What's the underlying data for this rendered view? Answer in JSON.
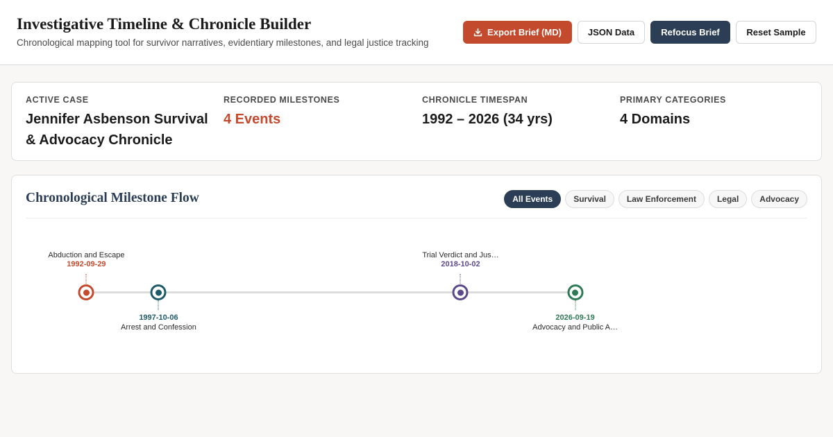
{
  "header": {
    "title": "Investigative Timeline & Chronicle Builder",
    "subtitle": "Chronological mapping tool for survivor narratives, evidentiary milestones, and legal justice tracking",
    "buttons": {
      "export": "Export Brief (MD)",
      "export_icon": "download-icon",
      "json": "JSON Data",
      "refocus": "Refocus Brief",
      "reset": "Reset Sample"
    }
  },
  "stats": [
    {
      "label": "ACTIVE CASE",
      "value": "Jennifer Asbenson Survival & Advocacy Chronicle"
    },
    {
      "label": "RECORDED MILESTONES",
      "value": "4 Events"
    },
    {
      "label": "CHRONICLE TIMESPAN",
      "value": "1992 – 2026 (34 yrs)"
    },
    {
      "label": "PRIMARY CATEGORIES",
      "value": "4 Domains"
    }
  ],
  "flow": {
    "title": "Chronological Milestone Flow",
    "filters": [
      "All Events",
      "Survival",
      "Law Enforcement",
      "Legal",
      "Advocacy"
    ],
    "active_filter": "All Events",
    "events": [
      {
        "title": "Abduction and Escape",
        "date": "1992-09-29",
        "category": "Survival",
        "color": "#c44a2d"
      },
      {
        "title": "Arrest and Confession",
        "date": "1997-10-06",
        "category": "Law Enforcement",
        "color": "#1e5a6a"
      },
      {
        "title": "Trial Verdict and Jus…",
        "date": "2018-10-02",
        "category": "Legal",
        "color": "#5b4a8b"
      },
      {
        "title": "Advocacy and Public A…",
        "date": "2026-09-19",
        "category": "Advocacy",
        "color": "#2e7a55"
      }
    ]
  },
  "colors": {
    "accent": "#c44a2d",
    "navy": "#2c3e55"
  }
}
